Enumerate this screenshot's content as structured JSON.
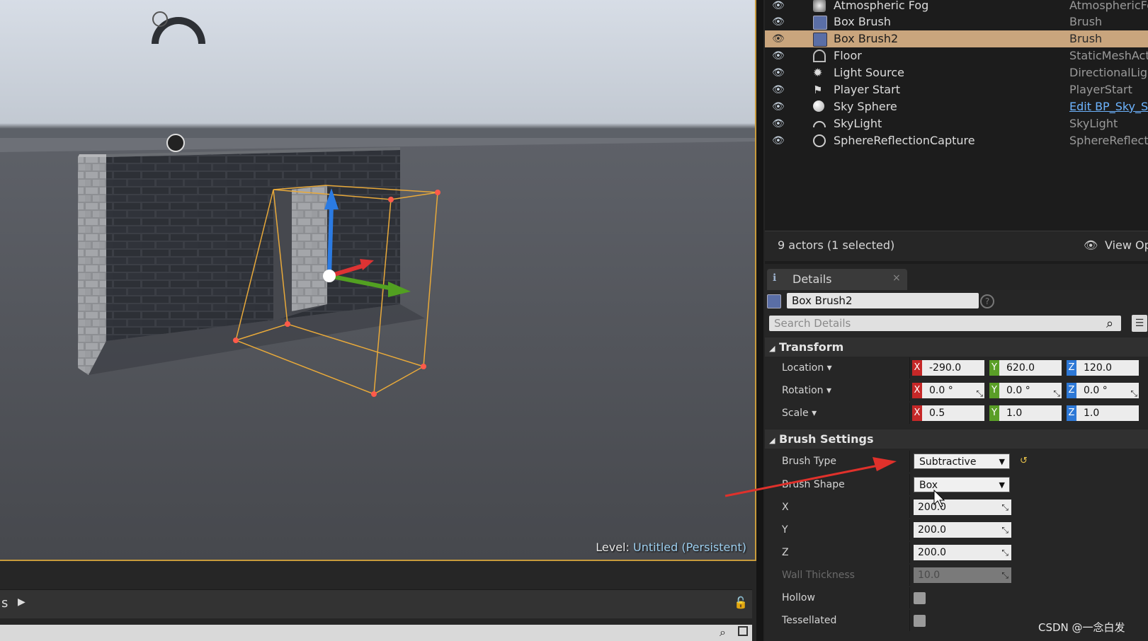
{
  "viewport": {
    "level_prefix": "Level:",
    "level_name": "Untitled (Persistent)"
  },
  "outliner": {
    "rows": [
      {
        "label": "Atmospheric Fog",
        "type": "AtmosphericFo",
        "icon": "fog-icon",
        "selected": false
      },
      {
        "label": "Box Brush",
        "type": "Brush",
        "icon": "brush-icon",
        "selected": false
      },
      {
        "label": "Box Brush2",
        "type": "Brush",
        "icon": "brush-icon",
        "selected": true
      },
      {
        "label": "Floor",
        "type": "StaticMeshActo",
        "icon": "static-mesh-icon",
        "selected": false
      },
      {
        "label": "Light Source",
        "type": "DirectionalLigh",
        "icon": "sun-icon",
        "selected": false
      },
      {
        "label": "Player Start",
        "type": "PlayerStart",
        "icon": "player-start-icon",
        "selected": false
      },
      {
        "label": "Sky Sphere",
        "type": "Edit BP_Sky_S",
        "icon": "sphere-icon",
        "selected": false,
        "link": true
      },
      {
        "label": "SkyLight",
        "type": "SkyLight",
        "icon": "skylight-icon",
        "selected": false
      },
      {
        "label": "SphereReflectionCapture",
        "type": "SphereReflectic",
        "icon": "reflection-capture-icon",
        "selected": false
      }
    ],
    "footer_count": "9 actors (1 selected)",
    "view_options": "View Op"
  },
  "details": {
    "tab_label": "Details",
    "object_name": "Box Brush2",
    "search_placeholder": "Search Details",
    "transform": {
      "title": "Transform",
      "location": {
        "label": "Location",
        "x": "-290.0",
        "y": "620.0",
        "z": "120.0"
      },
      "rotation": {
        "label": "Rotation",
        "x": "0.0 °",
        "y": "0.0 °",
        "z": "0.0 °"
      },
      "scale": {
        "label": "Scale",
        "x": "0.5",
        "y": "1.0",
        "z": "1.0"
      }
    },
    "brush": {
      "title": "Brush Settings",
      "type_label": "Brush Type",
      "type_value": "Subtractive",
      "shape_label": "Brush Shape",
      "shape_value": "Box",
      "x_label": "X",
      "x_value": "200.0",
      "y_label": "Y",
      "y_value": "200.0",
      "z_label": "Z",
      "z_value": "200.0",
      "wall_label": "Wall Thickness",
      "wall_value": "10.0",
      "hollow_label": "Hollow",
      "tess_label": "Tessellated"
    }
  },
  "content_bar": {
    "label": "s"
  },
  "watermark": "CSDN @一念白发",
  "colors": {
    "selection": "#c9a57d",
    "viewport_border": "#c89b3c",
    "axis_x": "#c62828",
    "axis_y": "#5a9e27",
    "axis_z": "#2d78d6",
    "annotation_arrow": "#e0312b"
  }
}
